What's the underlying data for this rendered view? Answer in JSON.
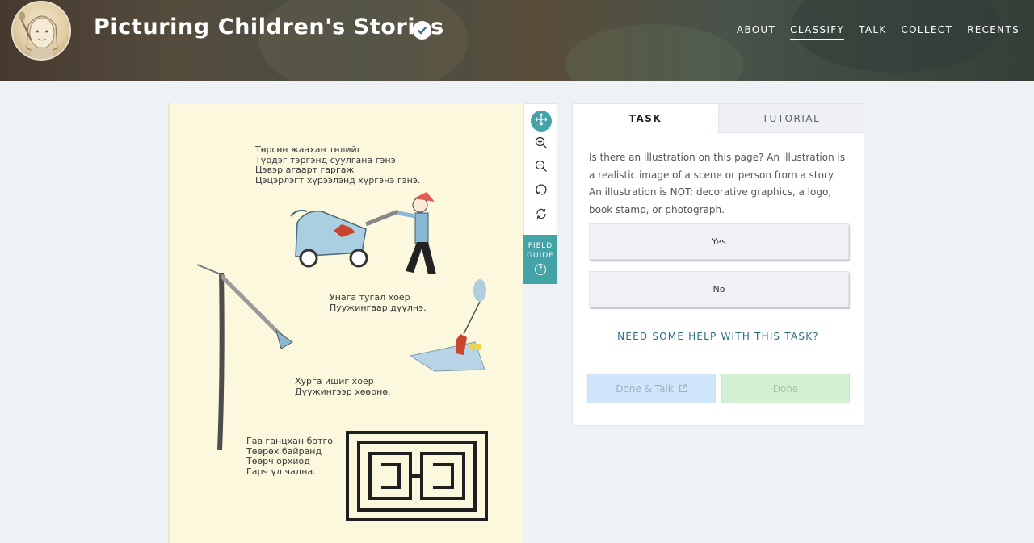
{
  "header": {
    "project_title": "Picturing Children's Stories",
    "nav": [
      {
        "label": "ABOUT",
        "active": false
      },
      {
        "label": "CLASSIFY",
        "active": true
      },
      {
        "label": "TALK",
        "active": false
      },
      {
        "label": "COLLECT",
        "active": false
      },
      {
        "label": "RECENTS",
        "active": false
      }
    ]
  },
  "subject": {
    "verse1": "Төрсөн жаахан төлийг\nТүрдэг тэргэнд суулгана гэнэ.\nЦэвэр агаарт гаргаж\nЦэцэрлэгт хүрээлэнд хүргэнэ гэнэ.",
    "verse2": "Унага тугал хоёр\nПуужингаар дүүлнэ.",
    "verse3": "Хурга ишиг хоёр\nДүүжингээр хөөрнө.",
    "verse4": "Гав ганцхан ботго\nТөөрөх байранд\nТөөрч орхиод\nГарч үл чадна."
  },
  "tools": [
    {
      "name": "move-icon",
      "active": true
    },
    {
      "name": "zoom-in-icon",
      "active": false
    },
    {
      "name": "zoom-out-icon",
      "active": false
    },
    {
      "name": "rotate-icon",
      "active": false
    },
    {
      "name": "reset-icon",
      "active": false
    }
  ],
  "field_guide": {
    "line1": "FIELD",
    "line2": "GUIDE",
    "icon": "?"
  },
  "task_panel": {
    "tabs": {
      "task": "TASK",
      "tutorial": "TUTORIAL"
    },
    "question": "Is there an illustration on this page? An illustration is a realistic image of a scene or person from a story. An illustration is NOT: decorative graphics, a logo, book stamp, or photograph.",
    "answers": {
      "yes": "Yes",
      "no": "No"
    },
    "help_link": "NEED SOME HELP WITH THIS TASK?",
    "done_talk": "Done & Talk",
    "done": "Done"
  },
  "colors": {
    "accent_teal": "#43a3a7",
    "page_background": "#eff2f5",
    "done_talk_bg": "#cfe6fb",
    "done_bg": "#d2f0d4"
  }
}
